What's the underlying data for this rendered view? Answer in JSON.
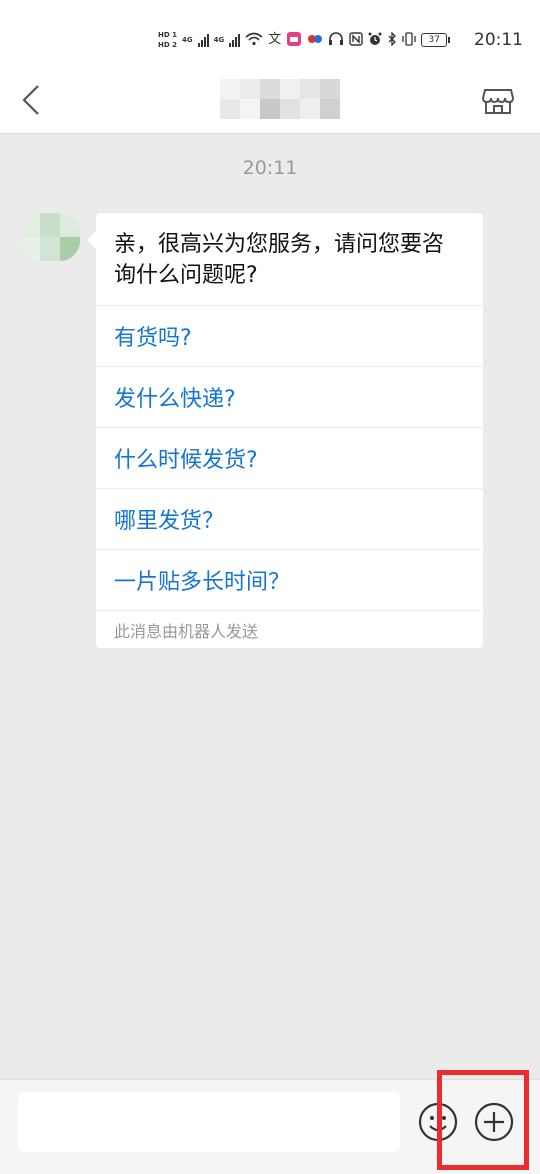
{
  "status_bar": {
    "hd1": "HD 1",
    "hd2": "HD 2",
    "net1": "4G",
    "net2": "4G",
    "battery": "37",
    "time": "20:11",
    "icons": [
      "hd-icon",
      "signal-icon",
      "signal-icon",
      "wifi-icon",
      "translate-icon",
      "tv-app-icon",
      "5g-app-icon",
      "headphones-icon",
      "nfc-icon",
      "alarm-icon",
      "bluetooth-icon",
      "vibrate-icon",
      "battery-icon"
    ]
  },
  "header": {
    "back_icon": "chevron-left-icon",
    "title": "",
    "store_icon": "store-icon"
  },
  "chat": {
    "timestamp": "20:11",
    "message": {
      "greeting": "亲，很高兴为您服务，请问您要咨询什么问题呢?",
      "options": [
        "有货吗?",
        "发什么快递?",
        "什么时候发货?",
        "哪里发货？",
        "一片贴多长时间？"
      ],
      "footnote": "此消息由机器人发送"
    }
  },
  "input": {
    "placeholder": "",
    "value": "",
    "emoji_icon": "emoji-icon",
    "plus_icon": "plus-circle-icon"
  },
  "colors": {
    "link": "#1475d3",
    "background": "#ebebeb",
    "highlight": "#ec2b2e"
  }
}
